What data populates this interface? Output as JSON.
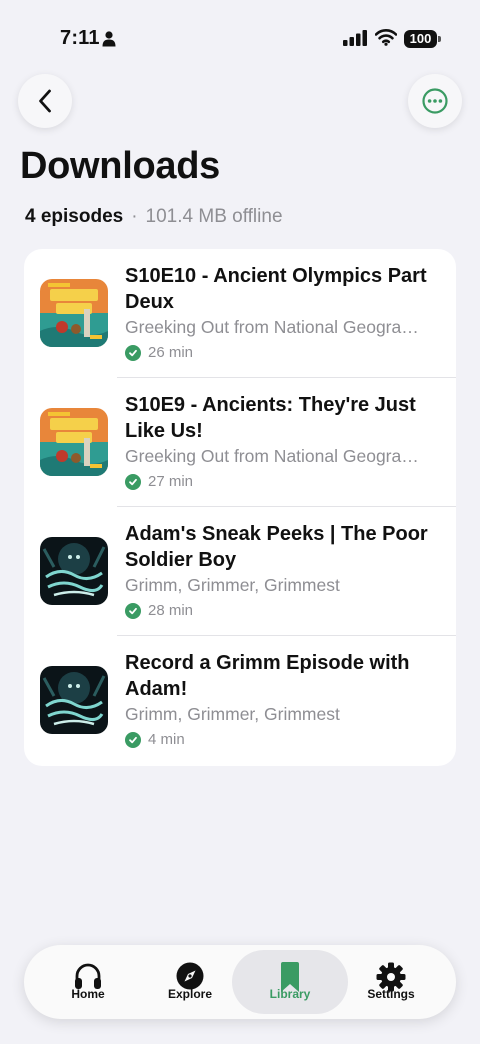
{
  "status_bar": {
    "time": "7:11",
    "battery": "100"
  },
  "header": {
    "title": "Downloads"
  },
  "summary": {
    "count": "4 episodes",
    "separator": "·",
    "size": "101.4 MB offline"
  },
  "colors": {
    "accent": "#3a9b63",
    "background": "#f2f2f7"
  },
  "episodes": [
    {
      "title": "S10E10 - Ancient Olympics Part Deux",
      "show": "Greeking Out from National Geographic Kids",
      "duration": "26 min",
      "art": "greeking-out"
    },
    {
      "title": "S10E9 - Ancients: They're Just Like Us!",
      "show": "Greeking Out from National Geographic Kids",
      "duration": "27 min",
      "art": "greeking-out"
    },
    {
      "title": "Adam's Sneak Peeks | The Poor Soldier Boy",
      "show": "Grimm, Grimmer, Grimmest",
      "duration": "28 min",
      "art": "grimm"
    },
    {
      "title": "Record a Grimm Episode with Adam!",
      "show": "Grimm, Grimmer, Grimmest",
      "duration": "4 min",
      "art": "grimm"
    }
  ],
  "tabs": [
    {
      "label": "Home",
      "icon": "headphones-icon"
    },
    {
      "label": "Explore",
      "icon": "compass-icon"
    },
    {
      "label": "Library",
      "icon": "bookmark-icon"
    },
    {
      "label": "Settings",
      "icon": "gear-icon"
    }
  ]
}
